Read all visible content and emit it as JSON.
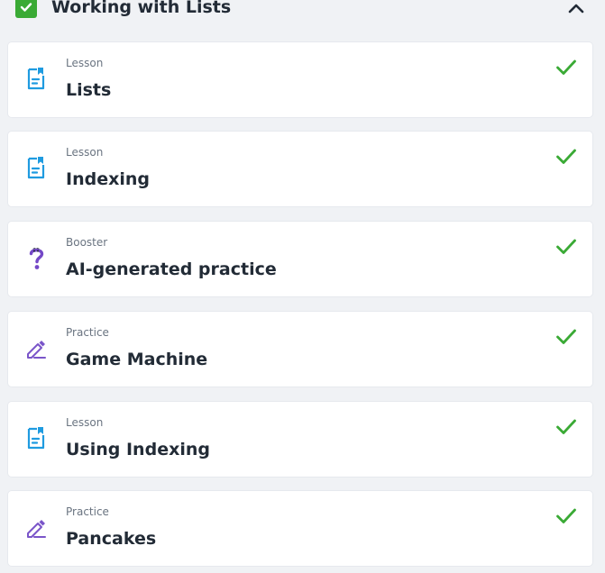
{
  "section": {
    "title": "Working with Lists",
    "completed": true
  },
  "items": [
    {
      "type": "Lesson",
      "title": "Lists",
      "icon": "lesson-icon",
      "completed": true
    },
    {
      "type": "Lesson",
      "title": "Indexing",
      "icon": "lesson-icon",
      "completed": true
    },
    {
      "type": "Booster",
      "title": "AI-generated practice",
      "icon": "booster-icon",
      "completed": true
    },
    {
      "type": "Practice",
      "title": "Game Machine",
      "icon": "practice-icon",
      "completed": true
    },
    {
      "type": "Lesson",
      "title": "Using Indexing",
      "icon": "lesson-icon",
      "completed": true
    },
    {
      "type": "Practice",
      "title": "Pancakes",
      "icon": "practice-icon",
      "completed": true
    }
  ],
  "colors": {
    "accent_green": "#3aaa35",
    "lesson_blue": "#1f9be0",
    "practice_purple": "#7a55c9",
    "booster_purple": "#7448c7"
  }
}
